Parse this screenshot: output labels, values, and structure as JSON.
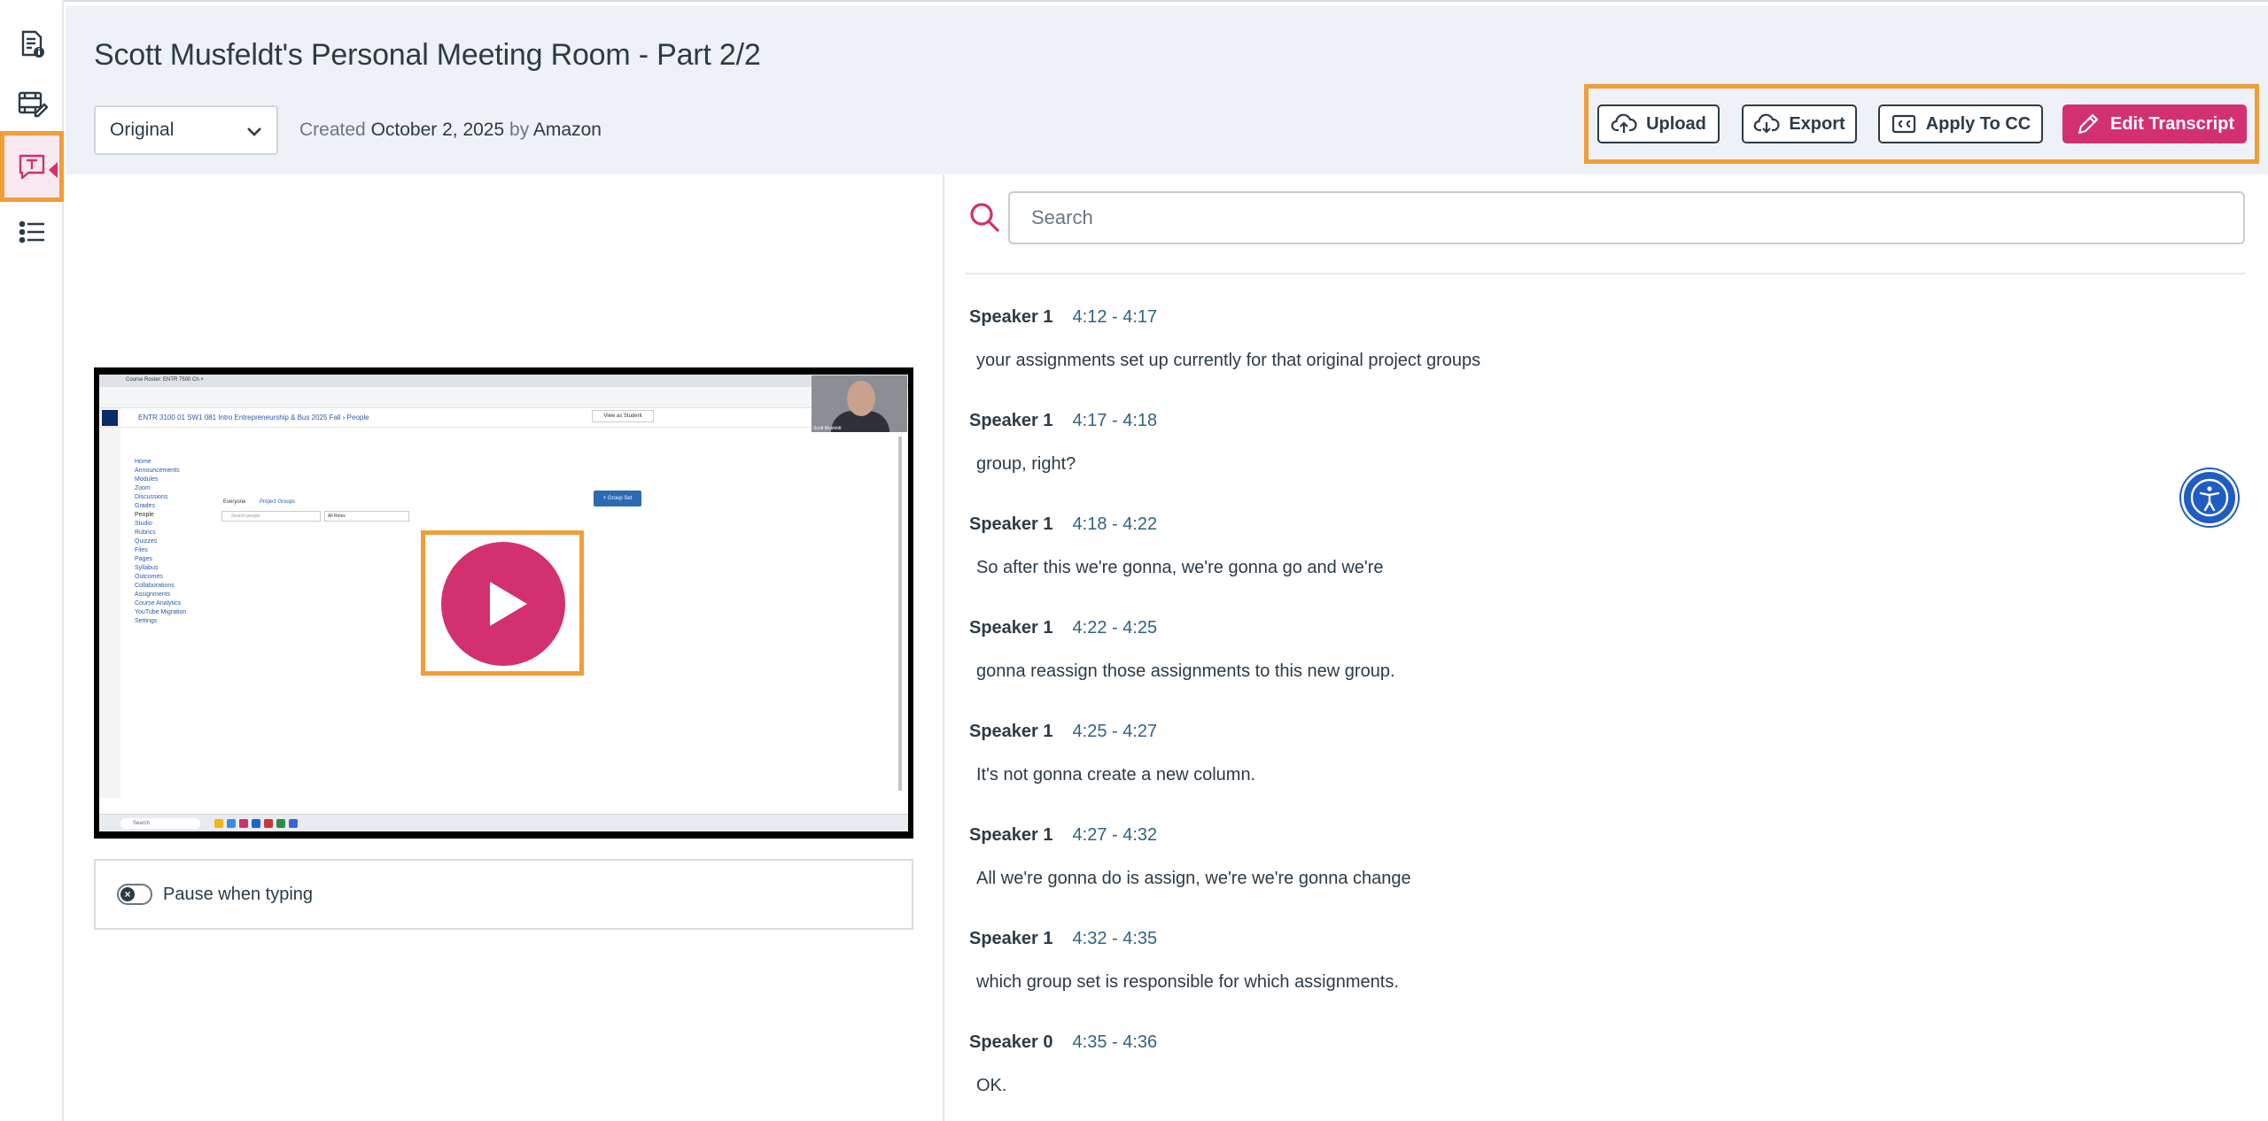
{
  "header": {
    "title": "Scott Musfeldt's Personal Meeting Room - Part 2/2",
    "version_select": "Original",
    "created_label": "Created",
    "created_date": "October 2, 2025",
    "by_label": "by",
    "author": "Amazon"
  },
  "toolbar": {
    "upload": "Upload",
    "export": "Export",
    "apply_cc": "Apply To CC",
    "edit_transcript": "Edit Transcript"
  },
  "player": {
    "pause_when_typing": "Pause when typing",
    "toggle_state": "off"
  },
  "thumbnail": {
    "tab_title": "Course Roster: ENTR 7500 Ch ×",
    "course_title": "ENTR 3100 01 SW1 081 Intro Entrepreneurship & Bus 2025 Fall  ›  People",
    "view_as_student": "View as Student",
    "tabs": [
      "Everyone",
      "Project Groups"
    ],
    "search_placeholder": "Search people",
    "roles": "All Roles",
    "group_set_button": "+ Group Set",
    "webcam_name": "Scott Musfeldt",
    "taskbar_search": "Search",
    "nav": [
      "Home",
      "Announcements",
      "Modules",
      "Zoom",
      "Discussions",
      "Grades",
      "People",
      "Studio",
      "Rubrics",
      "Quizzes",
      "Files",
      "Pages",
      "Syllabus",
      "Outcomes",
      "Collaborations",
      "Assignments",
      "Course Analytics",
      "YouTube Migration",
      "Settings"
    ]
  },
  "search": {
    "placeholder": "Search"
  },
  "transcript": [
    {
      "speaker": "Speaker 1",
      "time": "4:12 - 4:17",
      "text": "your assignments set up currently for that original project groups"
    },
    {
      "speaker": "Speaker 1",
      "time": "4:17 - 4:18",
      "text": "group, right?"
    },
    {
      "speaker": "Speaker 1",
      "time": "4:18 - 4:22",
      "text": "So after this we're gonna, we're gonna go and we're"
    },
    {
      "speaker": "Speaker 1",
      "time": "4:22 - 4:25",
      "text": "gonna reassign those assignments to this new group."
    },
    {
      "speaker": "Speaker 1",
      "time": "4:25 - 4:27",
      "text": "It's not gonna create a new column."
    },
    {
      "speaker": "Speaker 1",
      "time": "4:27 - 4:32",
      "text": "All we're gonna do is assign, we're we're gonna change"
    },
    {
      "speaker": "Speaker 1",
      "time": "4:32 - 4:35",
      "text": "which group set is responsible for which assignments."
    },
    {
      "speaker": "Speaker 0",
      "time": "4:35 - 4:36",
      "text": "OK."
    }
  ],
  "colors": {
    "accent": "#d3306f",
    "highlight": "#f29d38",
    "header_bg": "#eef2f6",
    "timestamp": "#31637c",
    "a11y": "#1f5cc4"
  },
  "icons": {
    "rail": [
      "document-info-icon",
      "video-edit-icon",
      "transcript-icon",
      "list-settings-icon"
    ],
    "upload": "cloud-upload-icon",
    "export": "cloud-download-icon",
    "apply_cc": "closed-caption-icon",
    "edit": "pencil-icon",
    "search": "search-icon",
    "play": "play-icon",
    "accessibility": "accessibility-icon"
  }
}
